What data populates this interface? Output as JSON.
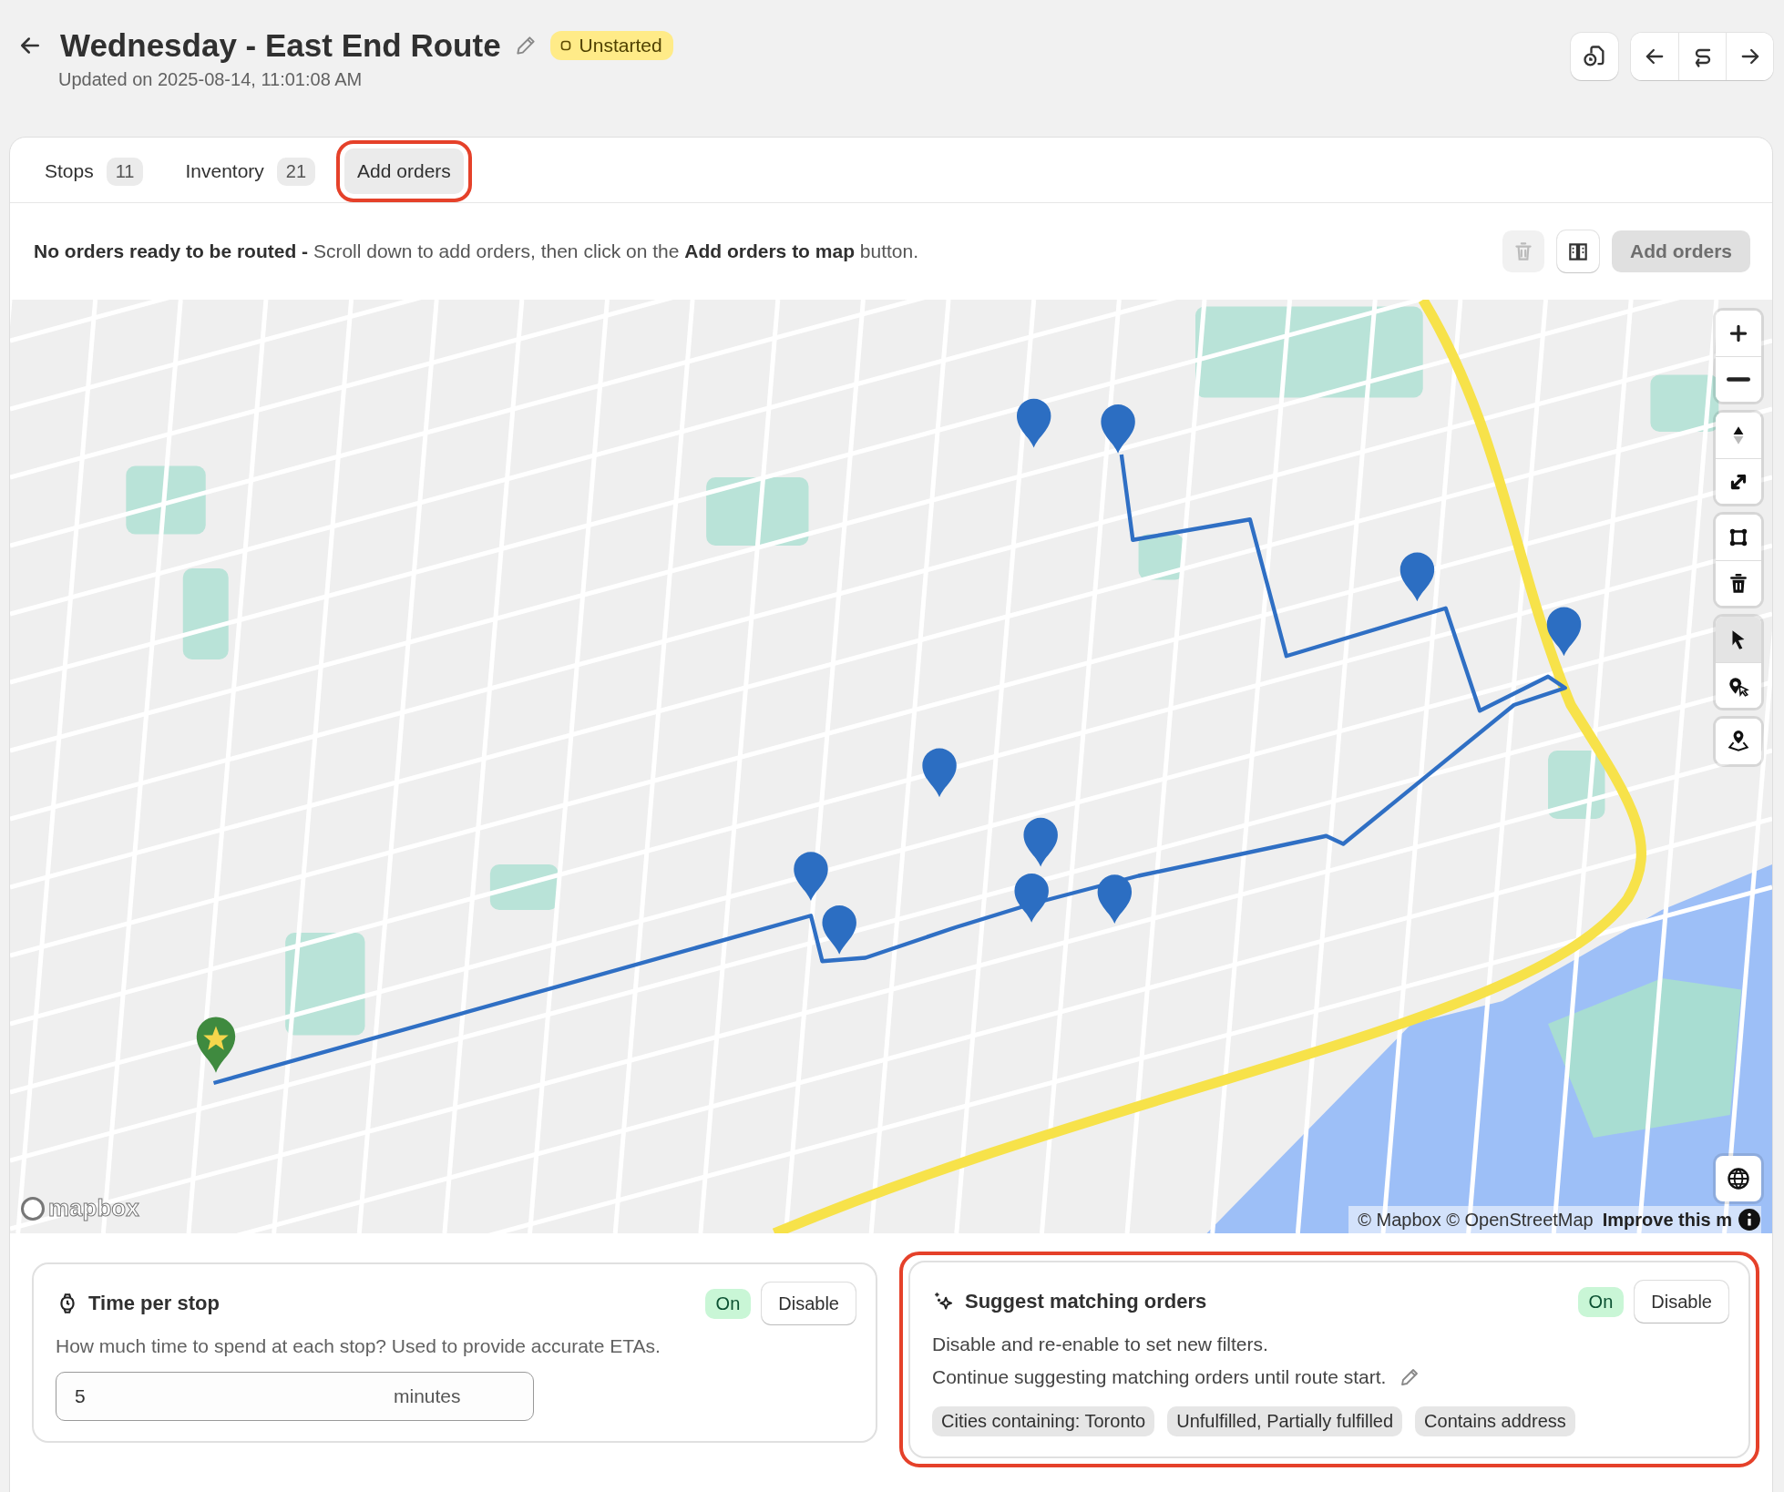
{
  "header": {
    "title": "Wednesday - East End Route",
    "status": "Unstarted",
    "updated": "Updated on 2025-08-14, 11:01:08 AM"
  },
  "header_actions": [
    {
      "kind": "timeline"
    }
  ],
  "nav_actions": [
    {
      "kind": "back"
    },
    {
      "kind": "swap"
    },
    {
      "kind": "forward"
    }
  ],
  "tabs": [
    {
      "label": "Stops",
      "count": "11",
      "selected": false,
      "highlighted": false
    },
    {
      "label": "Inventory",
      "count": "21",
      "selected": false,
      "highlighted": false
    },
    {
      "label": "Add orders",
      "selected": true,
      "highlighted": true
    }
  ],
  "notice": "**No orders ready to be routed -** Scroll down to add orders, then click on the **Add orders to map** button.",
  "notice_actions": [
    {
      "kind": "delete",
      "disabled": true
    },
    {
      "kind": "guide",
      "disabled": false
    },
    {
      "kind": "primary",
      "label": "Add orders",
      "disabled": true
    }
  ],
  "map": {
    "controls": [
      [
        {
          "kind": "zoom-in"
        },
        {
          "kind": "zoom-out"
        }
      ],
      [
        {
          "kind": "compass"
        },
        {
          "kind": "fullscreen"
        }
      ],
      [
        {
          "kind": "polygon"
        },
        {
          "kind": "trash"
        }
      ],
      [
        {
          "kind": "pointer",
          "selected": true
        },
        {
          "kind": "pin-select",
          "selected": false
        }
      ],
      [
        {
          "kind": "pin-map"
        }
      ]
    ],
    "logo": "mapbox",
    "attribution": "© Mapbox © OpenStreetMap",
    "improve_link": "Improve this m"
  },
  "settings": [
    {
      "kind": "time",
      "title": "Time per stop",
      "status": "On",
      "action": "Disable",
      "highlighted": false,
      "lines": [
        "How much time to spend at each stop? Used to provide accurate ETAs."
      ],
      "input": {
        "value": "5",
        "unit": "minutes"
      }
    },
    {
      "kind": "suggest",
      "title": "Suggest matching orders",
      "status": "On",
      "action": "Disable",
      "highlighted": true,
      "lines": [
        "Disable and re-enable to set new filters.",
        "Continue suggesting matching orders until route start."
      ],
      "filters": [
        "Cities containing: Toronto",
        "Unfulfilled, Partially fulfilled",
        "Contains address"
      ]
    }
  ]
}
